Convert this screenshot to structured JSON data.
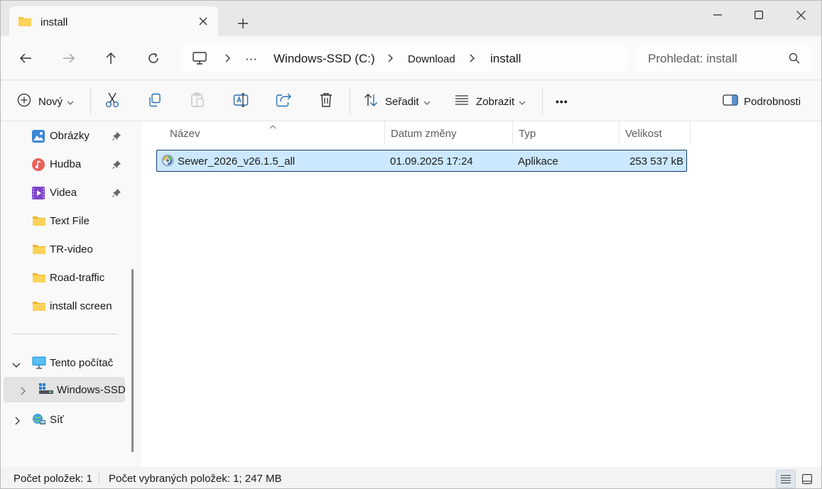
{
  "tab": {
    "title": "install"
  },
  "address": {
    "ellipsis": "···",
    "crumbs": [
      "Windows-SSD (C:)",
      "Download",
      "install"
    ]
  },
  "search": {
    "placeholder": "Prohledat: install"
  },
  "commands": {
    "new_label": "Nový",
    "sort_label": "Seřadit",
    "view_label": "Zobrazit",
    "more_label": "•••",
    "details_label": "Podrobnosti"
  },
  "nav": {
    "quick": [
      {
        "label": "Obrázky",
        "icon": "pictures-icon"
      },
      {
        "label": "Hudba",
        "icon": "music-icon"
      },
      {
        "label": "Videa",
        "icon": "videos-icon"
      },
      {
        "label": "Text File",
        "icon": "folder-icon"
      },
      {
        "label": "TR-video",
        "icon": "folder-icon"
      },
      {
        "label": "Road-traffic",
        "icon": "folder-icon"
      },
      {
        "label": "install screen",
        "icon": "folder-icon"
      }
    ],
    "this_pc": "Tento počítač",
    "drive": "Windows-SSD",
    "network": "Síť"
  },
  "columns": [
    "Název",
    "Datum změny",
    "Typ",
    "Velikost"
  ],
  "files": [
    {
      "name": "Sewer_2026_v26.1.5_all",
      "modified": "01.09.2025 17:24",
      "type": "Aplikace",
      "size": "253 537 kB"
    }
  ],
  "status": {
    "count": "Počet položek: 1",
    "selected": "Počet vybraných položek: 1; 247 MB"
  },
  "colors": {
    "accent": "#0067c0",
    "selection": "#cce8ff",
    "folder": "#f8c43a"
  }
}
